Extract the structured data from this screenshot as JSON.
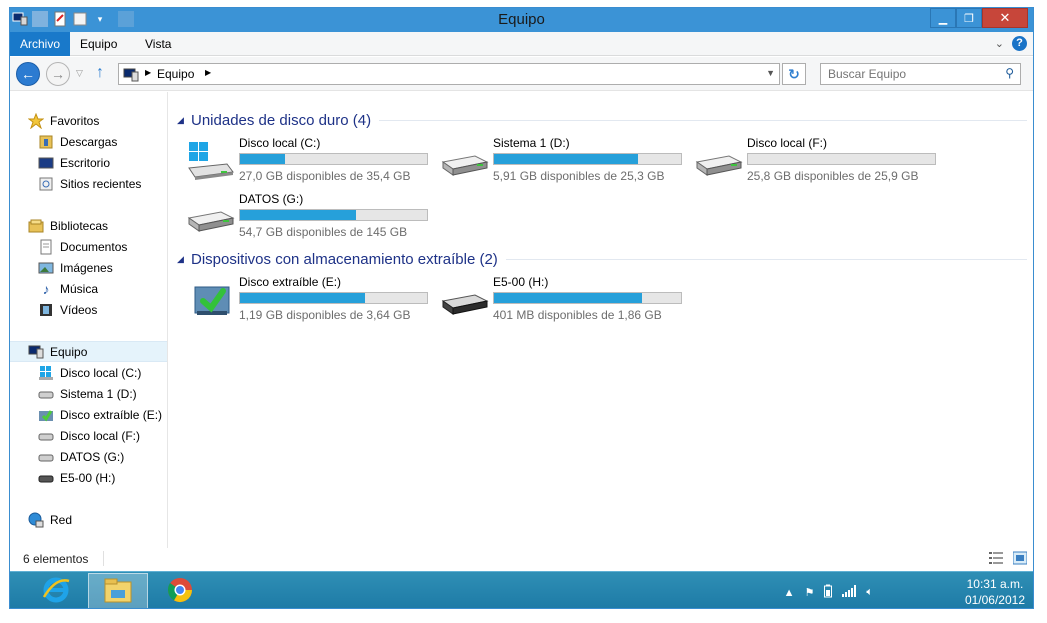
{
  "window": {
    "title": "Equipo"
  },
  "ribbon": {
    "tabs": [
      "Archivo",
      "Equipo",
      "Vista"
    ]
  },
  "address": {
    "crumb": "Equipo",
    "search_placeholder": "Buscar Equipo"
  },
  "nav": {
    "favorites": {
      "label": "Favoritos",
      "items": [
        "Descargas",
        "Escritorio",
        "Sitios recientes"
      ]
    },
    "libraries": {
      "label": "Bibliotecas",
      "items": [
        "Documentos",
        "Imágenes",
        "Música",
        "Vídeos"
      ]
    },
    "computer": {
      "label": "Equipo",
      "items": [
        "Disco local (C:)",
        "Sistema 1 (D:)",
        "Disco extraíble (E:)",
        "Disco local (F:)",
        "DATOS (G:)",
        "E5-00 (H:)"
      ]
    },
    "network": {
      "label": "Red"
    }
  },
  "groups": [
    {
      "name": "Unidades de disco duro (4)",
      "drives": [
        {
          "name": "Disco local (C:)",
          "info": "27,0 GB disponibles de 35,4 GB",
          "used_fraction": 0.24,
          "icon": "windows-drive-icon"
        },
        {
          "name": "Sistema 1 (D:)",
          "info": "5,91 GB disponibles de 25,3 GB",
          "used_fraction": 0.77,
          "icon": "hard-drive-icon"
        },
        {
          "name": "Disco local (F:)",
          "info": "25,8 GB disponibles de 25,9 GB",
          "used_fraction": 0.0,
          "icon": "hard-drive-icon"
        },
        {
          "name": "DATOS (G:)",
          "info": "54,7 GB disponibles de 145 GB",
          "used_fraction": 0.62,
          "icon": "hard-drive-icon"
        }
      ]
    },
    {
      "name": "Dispositivos con almacenamiento extraíble (2)",
      "drives": [
        {
          "name": "Disco extraíble (E:)",
          "info": "1,19 GB disponibles de 3,64 GB",
          "used_fraction": 0.67,
          "icon": "removable-drive-icon"
        },
        {
          "name": "E5-00 (H:)",
          "info": "401 MB disponibles de 1,86 GB",
          "used_fraction": 0.79,
          "icon": "portable-device-icon"
        }
      ]
    }
  ],
  "status": {
    "count": "6 elementos"
  },
  "taskbar": {
    "time": "10:31 a.m.",
    "date": "01/06/2012"
  }
}
